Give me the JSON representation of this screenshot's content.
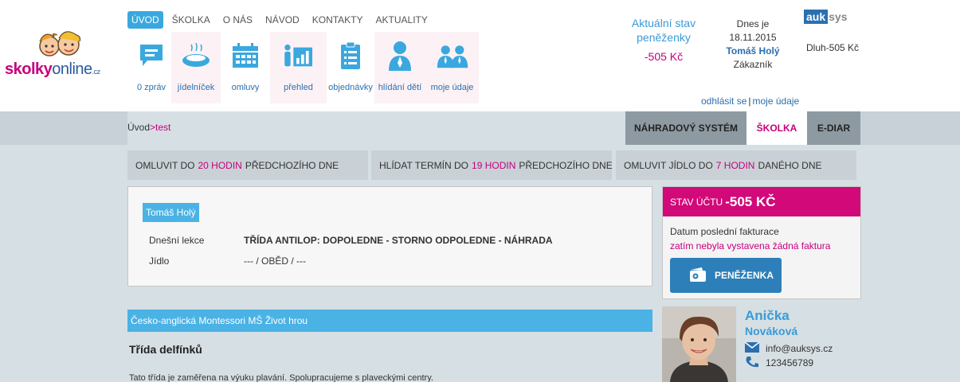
{
  "brand": {
    "logo_main": "skolky",
    "logo_second": "online",
    "logo_tld": ".cz",
    "vendor_box": "auk",
    "vendor_rest": "sys"
  },
  "topnav": [
    {
      "label": "ÚVOD",
      "active": true
    },
    {
      "label": "ŠKOLKA",
      "active": false
    },
    {
      "label": "O NÁS",
      "active": false
    },
    {
      "label": "NÁVOD",
      "active": false
    },
    {
      "label": "KONTAKTY",
      "active": false
    },
    {
      "label": "AKTUALITY",
      "active": false
    }
  ],
  "tiles": [
    {
      "label": "0 zpráv",
      "icon": "message-icon"
    },
    {
      "label": "jídelníček",
      "icon": "food-plate-icon"
    },
    {
      "label": "omluvy",
      "icon": "calendar-icon"
    },
    {
      "label": "přehled",
      "icon": "overview-chart-icon"
    },
    {
      "label": "objednávky",
      "icon": "clipboard-icon"
    },
    {
      "label": "hlídání dětí",
      "icon": "babysitter-icon"
    },
    {
      "label": "moje údaje",
      "icon": "users-icon"
    }
  ],
  "wallet": {
    "title": "Aktuální stav peněženky",
    "value": "-505 Kč"
  },
  "user": {
    "today_label": "Dnes je",
    "date": "18.11.2015",
    "name": "Tomáš Holý",
    "role": "Zákazník",
    "logout": "odhlásit se",
    "separator": "|",
    "my_data": "moje údaje",
    "debt": "Dluh-505 Kč"
  },
  "breadcrumb": {
    "home": "Úvod",
    "separator": ">",
    "current": "test"
  },
  "system_tabs": [
    {
      "label": "NÁHRADOVÝ SYSTÉM"
    },
    {
      "label": "ŠKOLKA"
    },
    {
      "label": "E-DIAR"
    }
  ],
  "rules": [
    {
      "before": "Omluvit do",
      "highlight": "20 hodin",
      "after": "předchozího dne"
    },
    {
      "before": "Hlídat termín do",
      "highlight": "19 hodin",
      "after": "předchozího dne"
    },
    {
      "before": "Omluvit jídlo do",
      "highlight": "7 hodin",
      "after": "daného dne"
    }
  ],
  "child": {
    "name": "Tomáš Holý",
    "lesson_label": "Dnešní lekce",
    "lesson_value": "TŘÍDA ANTILOP: DOPOLEDNE - STORNO ODPOLEDNE - NÁHRADA",
    "food_label": "Jídlo",
    "food_value": "--- / OBĚD / ---"
  },
  "account": {
    "title": "Stav účtu",
    "amount": "-505 KČ",
    "invoice_label": "Datum poslední fakturace",
    "invoice_value": "zatím nebyla vystavena žádná faktura",
    "wallet_button": "Peněženka"
  },
  "school": {
    "name": "Česko-anglická Montessori MŠ Život hrou",
    "class_title": "Třída delfínků",
    "class_desc": "Tato třída je zaměřena na výuku plavání. Spolupracujeme s plaveckými centry."
  },
  "contact": {
    "first_name": "Anička",
    "last_name": "Nováková",
    "email": "info@auksys.cz",
    "phone": "123456789"
  },
  "colors": {
    "accent_pink": "#c6007e",
    "accent_blue": "#3aa8de",
    "icon_blue": "#2a6fb0"
  }
}
